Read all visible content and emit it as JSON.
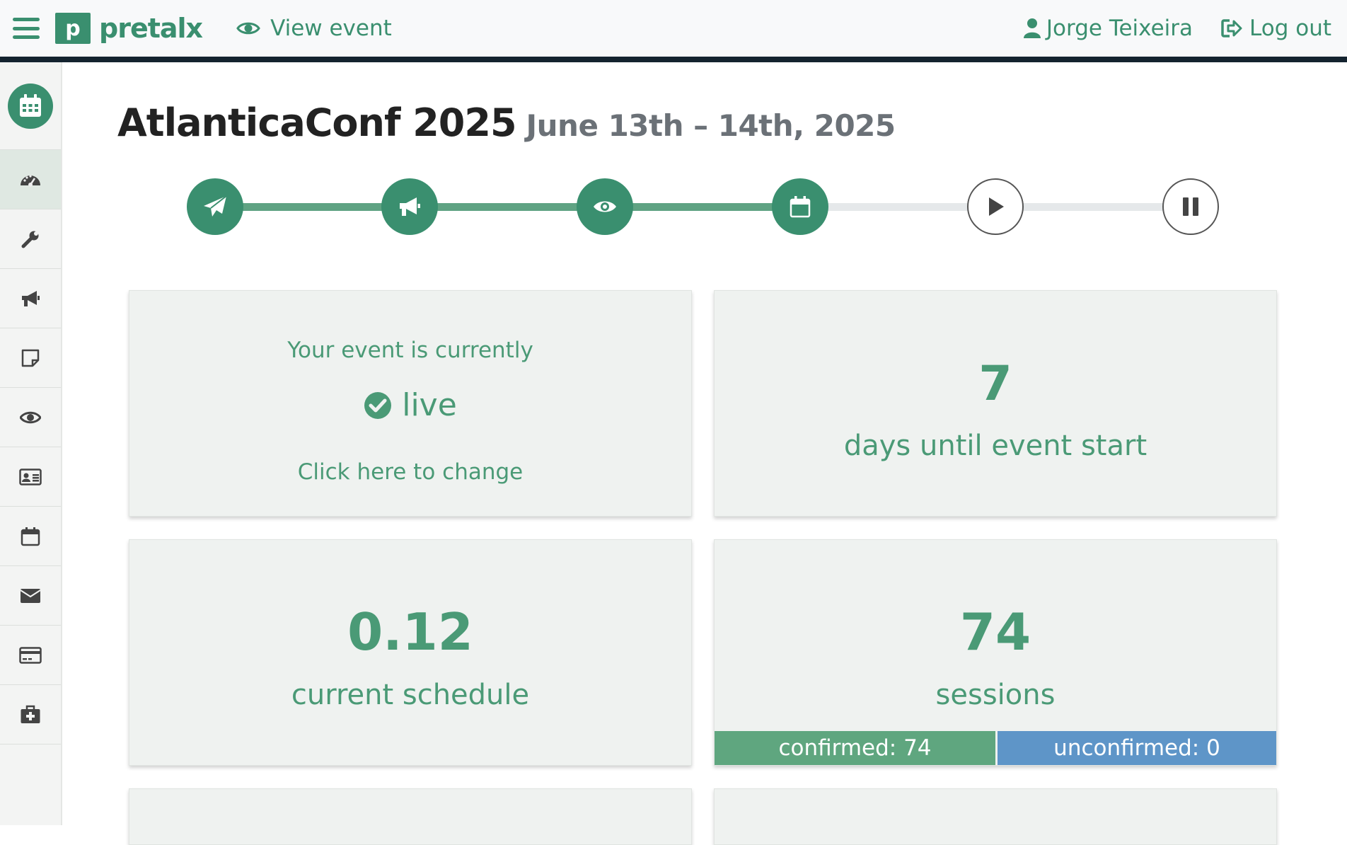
{
  "nav": {
    "brand": "pretalx",
    "brand_letter": "p",
    "view_event": "View event",
    "user_name": "Jorge Teixeira",
    "logout": "Log out"
  },
  "colors": {
    "primary": "#3a8f6f",
    "navbar_border": "#14232f",
    "confirmed": "#5fa67f",
    "unconfirmed": "#5e95c8"
  },
  "sidebar": {
    "items": [
      {
        "icon": "dashboard-icon",
        "active": true
      },
      {
        "icon": "wrench-icon",
        "active": false
      },
      {
        "icon": "megaphone-icon",
        "active": false
      },
      {
        "icon": "sticky-note-icon",
        "active": false
      },
      {
        "icon": "eye-icon",
        "active": false
      },
      {
        "icon": "id-card-icon",
        "active": false
      },
      {
        "icon": "calendar-icon",
        "active": false
      },
      {
        "icon": "envelope-icon",
        "active": false
      },
      {
        "icon": "credit-card-icon",
        "active": false
      },
      {
        "icon": "medkit-icon",
        "active": false
      }
    ]
  },
  "event": {
    "title": "AtlanticaConf 2025",
    "dates": "June 13th – 14th, 2025"
  },
  "timeline": {
    "steps": [
      {
        "icon": "paper-plane-icon",
        "done": true
      },
      {
        "icon": "megaphone-icon",
        "done": true
      },
      {
        "icon": "eye-icon",
        "done": true
      },
      {
        "icon": "calendar-icon",
        "done": true
      },
      {
        "icon": "play-icon",
        "done": false
      },
      {
        "icon": "pause-icon",
        "done": false
      }
    ]
  },
  "cards": {
    "status": {
      "line1": "Your event is currently",
      "state": "live",
      "change": "Click here to change"
    },
    "countdown": {
      "value": "7",
      "label": "days until event start"
    },
    "schedule": {
      "value": "0.12",
      "label": "current schedule"
    },
    "sessions": {
      "value": "74",
      "label": "sessions",
      "confirmed": "confirmed: 74",
      "unconfirmed": "unconfirmed: 0"
    }
  }
}
